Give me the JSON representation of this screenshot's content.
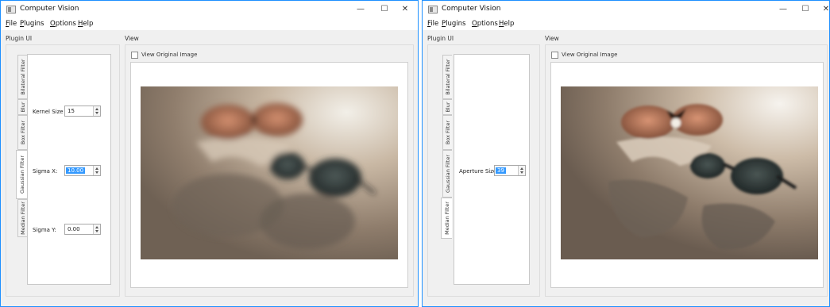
{
  "windows": [
    {
      "title": "Computer Vision",
      "controls": {
        "minimize": "—",
        "maximize": "☐",
        "close": "✕"
      },
      "menu": [
        {
          "label_u": "F",
          "label_rest": "ile"
        },
        {
          "label_u": "P",
          "label_rest": "lugins"
        },
        {
          "label_u": "O",
          "label_rest": "ptions"
        },
        {
          "label_u": "H",
          "label_rest": "elp"
        }
      ],
      "plugin_ui_label": "Plugin UI",
      "view_label": "View",
      "tabs": [
        "Bilateral Filter",
        "Blur",
        "Box Filter",
        "Gaussian Filter",
        "Median Filter"
      ],
      "active_tab": "Gaussian Filter",
      "fields": [
        {
          "label": "Kernel Size :",
          "value": "15",
          "selected": false
        },
        {
          "label": "Sigma X:",
          "value": "10.00",
          "selected": true
        },
        {
          "label": "Sigma Y:",
          "value": "0.00",
          "selected": false
        }
      ],
      "view_original_label": "View Original Image",
      "view_original_checked": false,
      "image_effect": "gaussian-blur"
    },
    {
      "title": "Computer Vision",
      "controls": {
        "minimize": "—",
        "maximize": "☐",
        "close": "✕"
      },
      "menu": [
        {
          "label_u": "F",
          "label_rest": "ile"
        },
        {
          "label_u": "P",
          "label_rest": "lugins"
        },
        {
          "label_u": "O",
          "label_rest": "ptions"
        },
        {
          "label_u": "H",
          "label_rest": "elp"
        }
      ],
      "plugin_ui_label": "Plugin UI",
      "view_label": "View",
      "tabs": [
        "Bilateral Filter",
        "Blur",
        "Box Filter",
        "Gaussian Filter",
        "Median Filter"
      ],
      "active_tab": "Median Filter",
      "fields": [
        {
          "label": "Aperture Size:",
          "value": "39",
          "selected": true
        }
      ],
      "view_original_label": "View Original Image",
      "view_original_checked": false,
      "image_effect": "median"
    }
  ],
  "colors": {
    "window_border": "#1e90ff",
    "selection": "#3399ff",
    "panel_bg": "#f0f0f0"
  },
  "icons": {
    "app": "app-window-icon",
    "spin": "spinbox-arrows-icon"
  }
}
